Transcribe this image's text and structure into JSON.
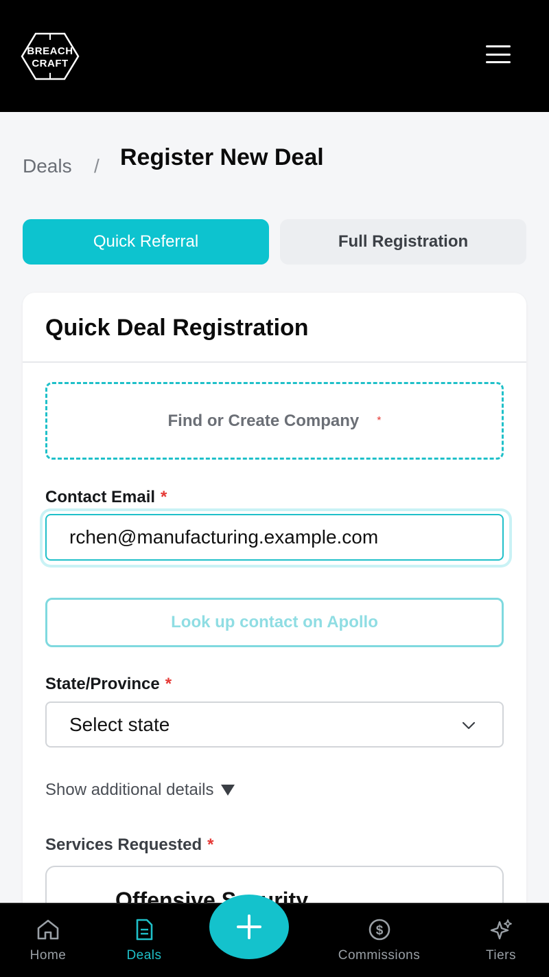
{
  "header": {
    "logo_line1": "BREACH",
    "logo_line2": "CRAFT",
    "menu_icon": "hamburger-menu-icon"
  },
  "breadcrumb": {
    "parent": "Deals",
    "separator": "/",
    "current": "Register New Deal"
  },
  "tabs": [
    {
      "label": "Quick Referral",
      "active": true
    },
    {
      "label": "Full Registration",
      "active": false
    }
  ],
  "form": {
    "title": "Quick Deal Registration",
    "company_picker": {
      "label": "Find or Create Company",
      "required_mark": "*"
    },
    "contact_email": {
      "label": "Contact Email",
      "required_mark": "*",
      "value": "rchen@manufacturing.example.com"
    },
    "apollo_button": {
      "label": "Look up contact on Apollo"
    },
    "state": {
      "label": "State/Province",
      "required_mark": "*",
      "selected": "Select state"
    },
    "additional_toggle": {
      "label": "Show additional details"
    },
    "services": {
      "label": "Services Requested",
      "required_mark": "*",
      "first_option": "Offensive Security"
    }
  },
  "bottom_nav": {
    "items": [
      {
        "label": "Home",
        "icon": "home-icon"
      },
      {
        "label": "Deals",
        "icon": "document-icon",
        "active": true
      },
      {
        "label": "Commissions",
        "icon": "dollar-circle-icon"
      },
      {
        "label": "Tiers",
        "icon": "sparkles-icon"
      }
    ],
    "fab_icon": "plus-icon"
  },
  "colors": {
    "accent": "#0dc3cf",
    "required": "#e53935",
    "header_bg": "#000000"
  }
}
